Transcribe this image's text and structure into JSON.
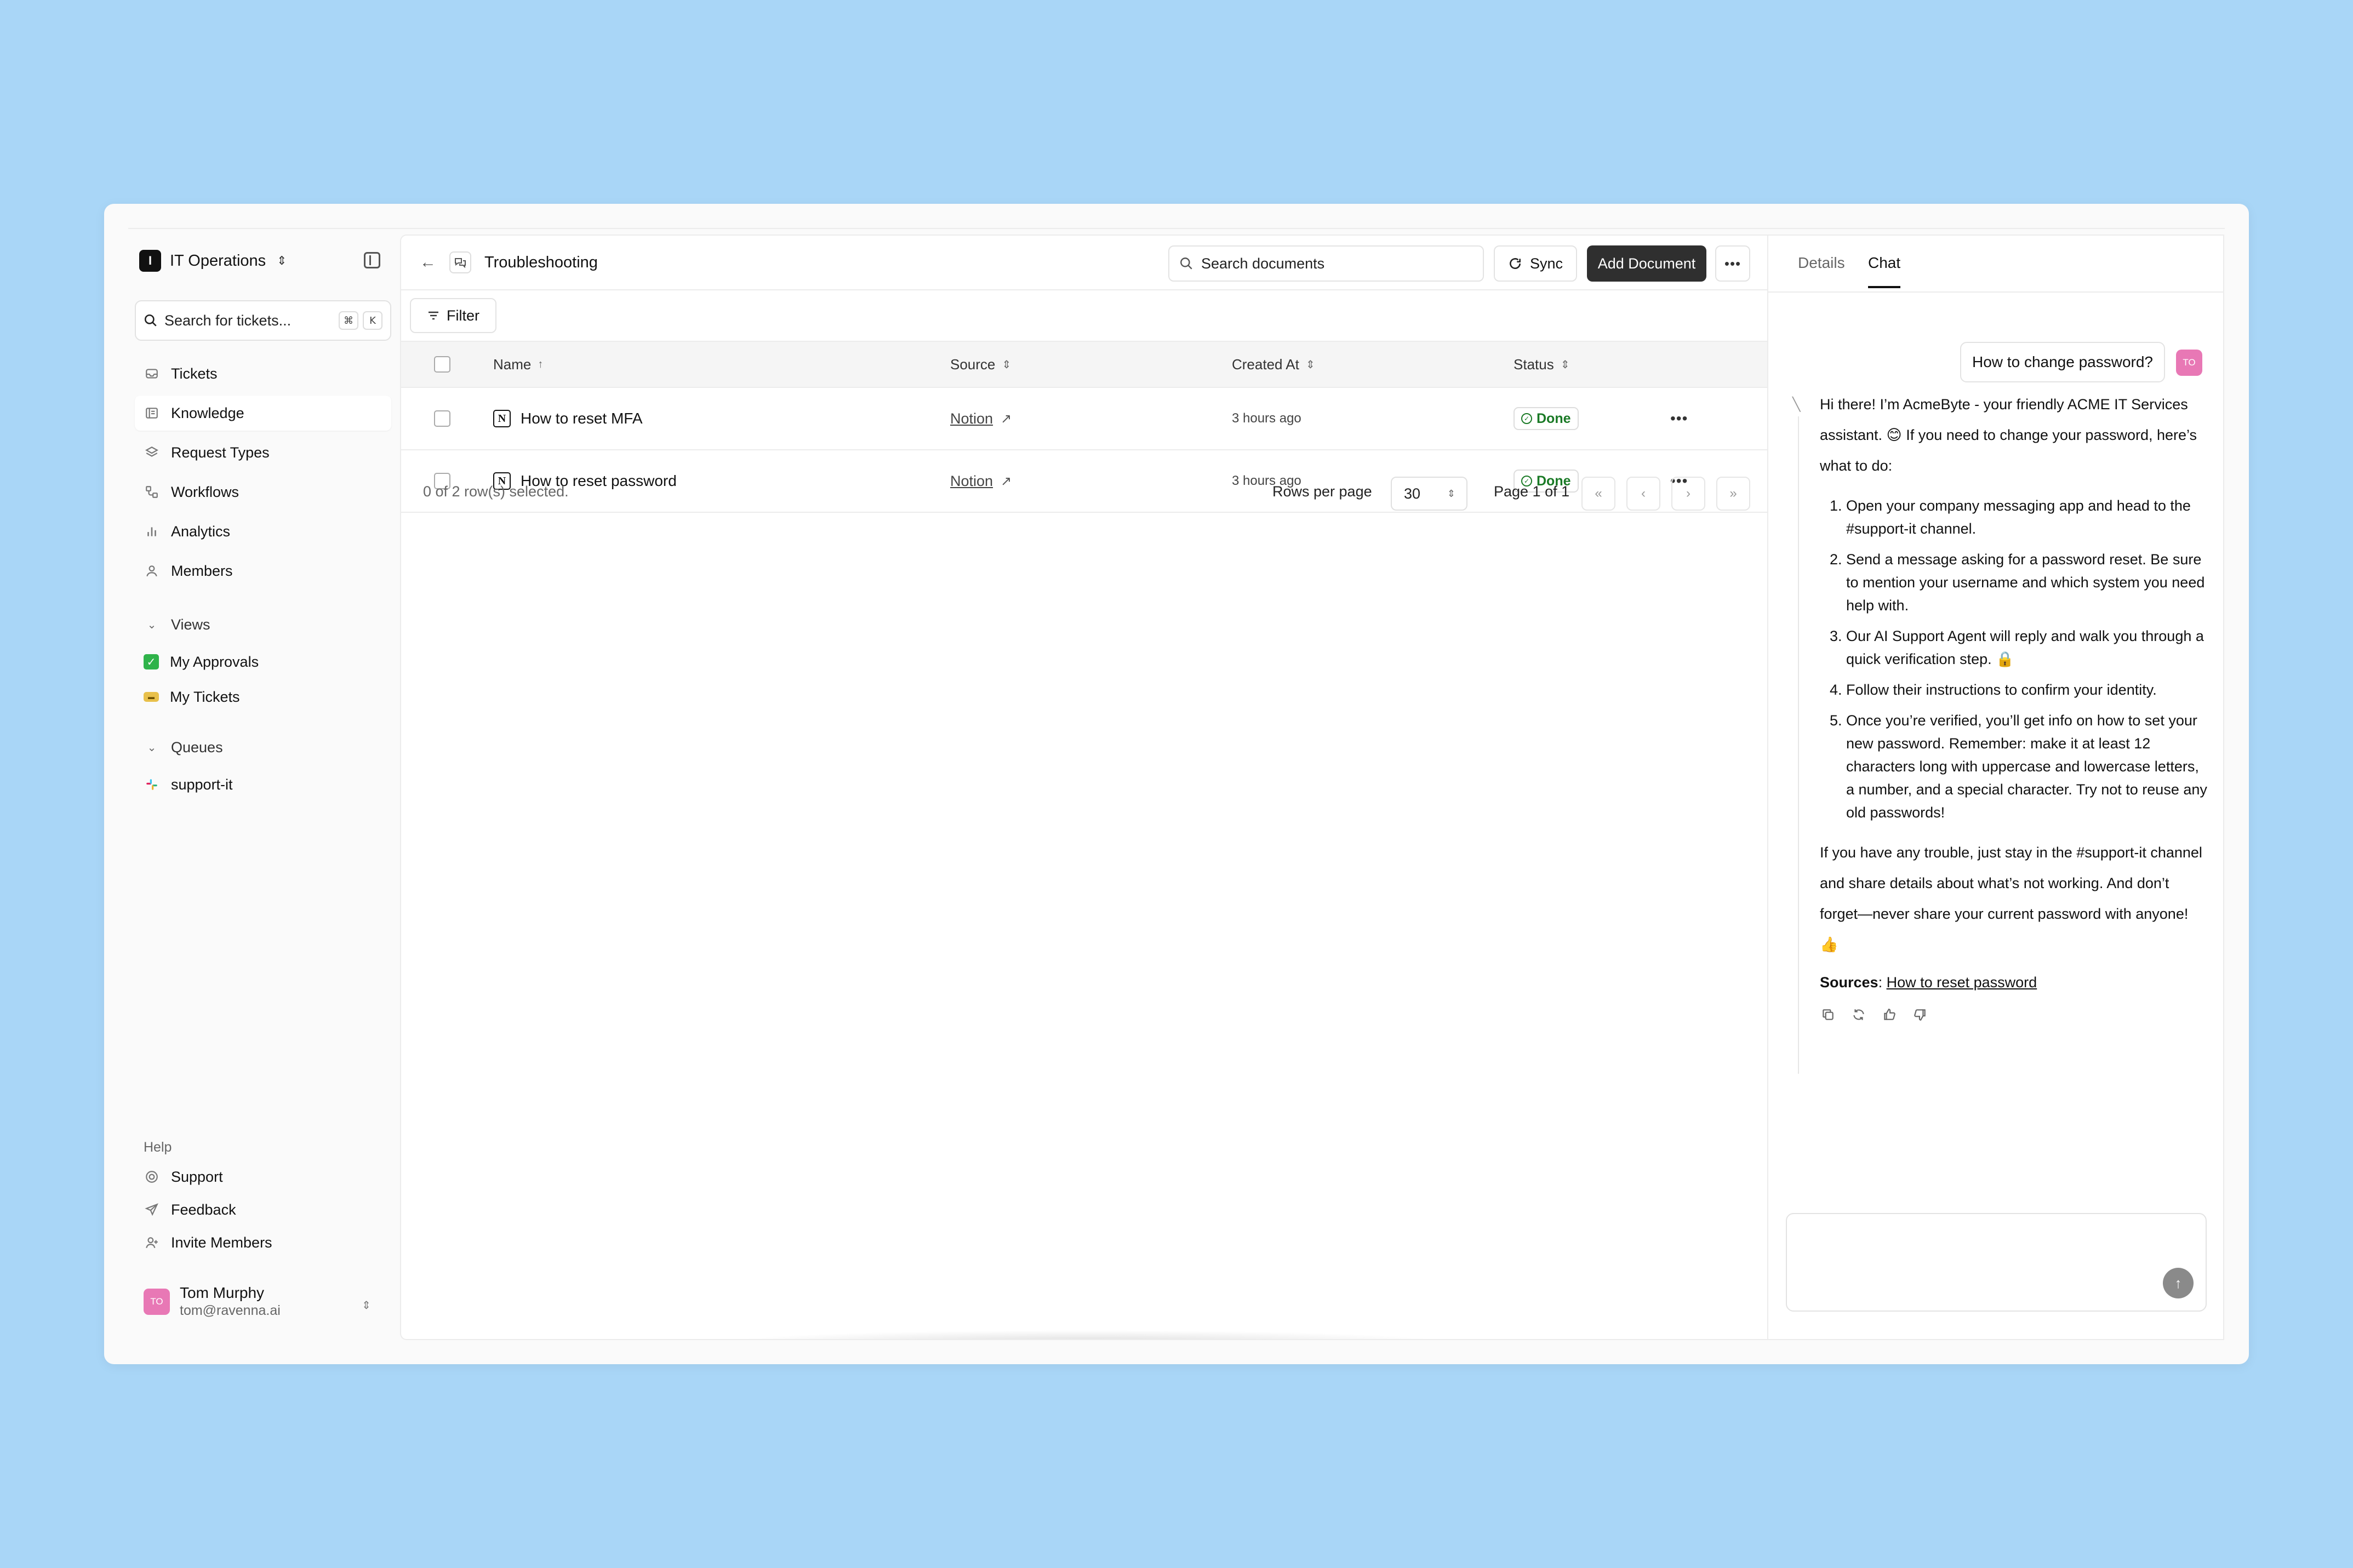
{
  "sidebar": {
    "workspace": {
      "badge": "I",
      "name": "IT Operations"
    },
    "search": {
      "placeholder": "Search for tickets...",
      "kbd1": "⌘",
      "kbd2": "K"
    },
    "nav": [
      {
        "label": "Tickets",
        "icon": "inbox-icon"
      },
      {
        "label": "Knowledge",
        "icon": "book-icon",
        "active": true
      },
      {
        "label": "Request Types",
        "icon": "layers-icon"
      },
      {
        "label": "Workflows",
        "icon": "workflow-icon"
      },
      {
        "label": "Analytics",
        "icon": "bar-chart-icon"
      },
      {
        "label": "Members",
        "icon": "user-icon"
      }
    ],
    "views_label": "Views",
    "views": [
      {
        "label": "My Approvals",
        "icon": "check-box-emoji"
      },
      {
        "label": "My Tickets",
        "icon": "ticket-emoji"
      }
    ],
    "queues_label": "Queues",
    "queues": [
      {
        "label": "support-it",
        "icon": "slack-icon"
      }
    ],
    "help_label": "Help",
    "help": [
      {
        "label": "Support",
        "icon": "life-buoy-icon"
      },
      {
        "label": "Feedback",
        "icon": "send-icon"
      },
      {
        "label": "Invite Members",
        "icon": "user-plus-icon"
      }
    ],
    "user": {
      "initials": "TO",
      "name": "Tom Murphy",
      "email": "tom@ravenna.ai"
    }
  },
  "main": {
    "breadcrumb_title": "Troubleshooting",
    "search_placeholder": "Search documents",
    "sync_label": "Sync",
    "add_label": "Add Document",
    "filter_label": "Filter",
    "columns": {
      "name": "Name",
      "source": "Source",
      "created": "Created At",
      "status": "Status"
    },
    "rows": [
      {
        "name": "How to reset MFA",
        "source": "Notion",
        "created": "3 hours ago",
        "status": "Done"
      },
      {
        "name": "How to reset password",
        "source": "Notion",
        "created": "3 hours ago",
        "status": "Done"
      }
    ],
    "selection_text": "0 of 2 row(s) selected.",
    "rows_per_page_label": "Rows per page",
    "rows_per_page": "30",
    "page_text": "Page 1 of 1"
  },
  "panel": {
    "tabs": [
      "Details",
      "Chat"
    ],
    "active_tab": "Chat",
    "user_message": "How to change password?",
    "user_initials": "TO",
    "bot_intro": "Hi there! I’m AcmeByte - your friendly ACME IT Services assistant. 😊 If you need to change your password, here’s what to do:",
    "steps": [
      "Open your company messaging app and head to the #support-it channel.",
      "Send a message asking for a password reset. Be sure to mention your username and which system you need help with.",
      "Our AI Support Agent will reply and walk you through a quick verification step. 🔒",
      "Follow their instructions to confirm your identity.",
      "Once you’re verified, you’ll get info on how to set your new password. Remember: make it at least 12 characters long with uppercase and lowercase letters, a number, and a special character. Try not to reuse any old passwords!"
    ],
    "bot_outro": "If you have any trouble, just stay in the #support-it channel and share details about what’s not working. And don’t forget—never share your current password with anyone! 👍",
    "sources_label": "Sources",
    "sources_link": "How to reset password"
  },
  "colors": {
    "background": "#a9d6f7",
    "primary_button": "#2f2f2f",
    "status_done": "#1a7a26",
    "avatar": "#e878b5"
  }
}
